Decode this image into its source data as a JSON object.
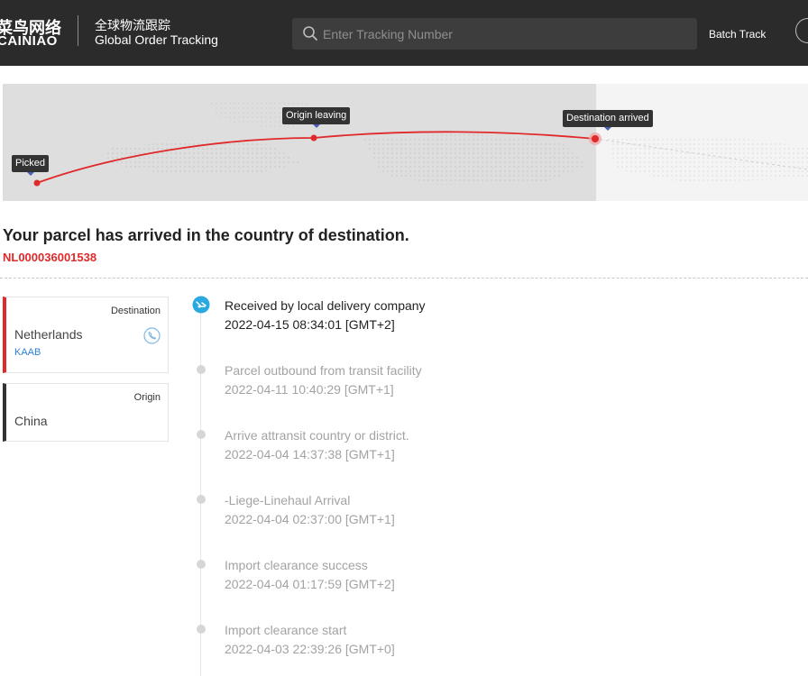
{
  "header": {
    "logo_cn": "菜鸟网络",
    "logo_en": "CAINIAO",
    "brand_cn": "全球物流跟踪",
    "brand_en": "Global Order Tracking",
    "search_placeholder": "Enter Tracking Number",
    "batch_track": "Batch Track"
  },
  "map": {
    "markers": [
      "Picked",
      "Origin leaving",
      "Destination arrived"
    ],
    "route_color": "#e0292a"
  },
  "status": {
    "title": "Your parcel has arrived in the country of destination.",
    "tracking_number": "NL000036001538"
  },
  "destination": {
    "label": "Destination",
    "country": "Netherlands",
    "carrier": "KAAB"
  },
  "origin": {
    "label": "Origin",
    "country": "China"
  },
  "timeline": [
    {
      "event": "Received by local delivery company",
      "time": "2022-04-15 08:34:01 [GMT+2]"
    },
    {
      "event": "Parcel outbound from transit facility",
      "time": "2022-04-11 10:40:29 [GMT+1]"
    },
    {
      "event": "Arrive attransit country or district.",
      "time": "2022-04-04 14:37:38 [GMT+1]"
    },
    {
      "event": "-Liege-Linehaul Arrival",
      "time": "2022-04-04 02:37:00 [GMT+1]"
    },
    {
      "event": "Import clearance success",
      "time": "2022-04-04 01:17:59 [GMT+2]"
    },
    {
      "event": "Import clearance start",
      "time": "2022-04-03 22:39:26 [GMT+0]"
    }
  ],
  "colors": {
    "header_bg": "#2b2b2b",
    "accent_red": "#e0292a",
    "link_blue": "#2d7fd6",
    "active_icon": "#2aa8e0"
  }
}
